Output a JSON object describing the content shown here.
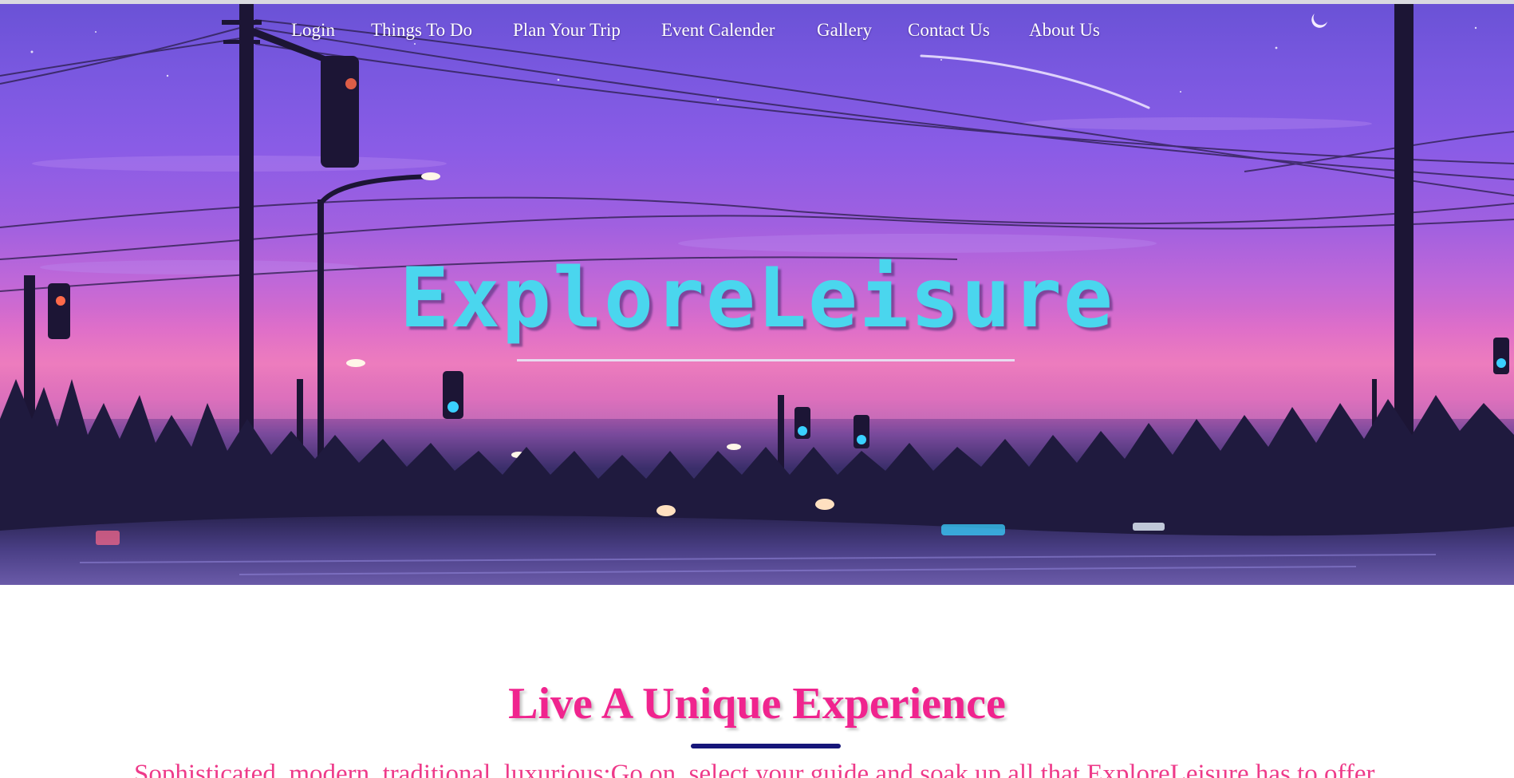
{
  "nav": {
    "items": [
      {
        "label": "Login"
      },
      {
        "label": "Things To Do"
      },
      {
        "label": "Plan Your Trip"
      },
      {
        "label": "Event Calender"
      },
      {
        "label": "Gallery"
      },
      {
        "label": "Contact Us"
      },
      {
        "label": "About Us"
      }
    ]
  },
  "hero": {
    "logo_text": "ExploreLeisure",
    "scene": "dusk-street-powerlines-traffic-lights-pine-silhouettes"
  },
  "content": {
    "headline": "Live A Unique Experience",
    "tagline": "Sophisticated, modern, traditional, luxurious;Go on, select your guide and soak up all that ExploreLeisure has to offer."
  },
  "colors": {
    "logo": "#4ad6ee",
    "headline": "#f0248e",
    "tagline": "#ee3b8a",
    "headline_rule": "#16167a",
    "nav_text": "#ffffff"
  }
}
